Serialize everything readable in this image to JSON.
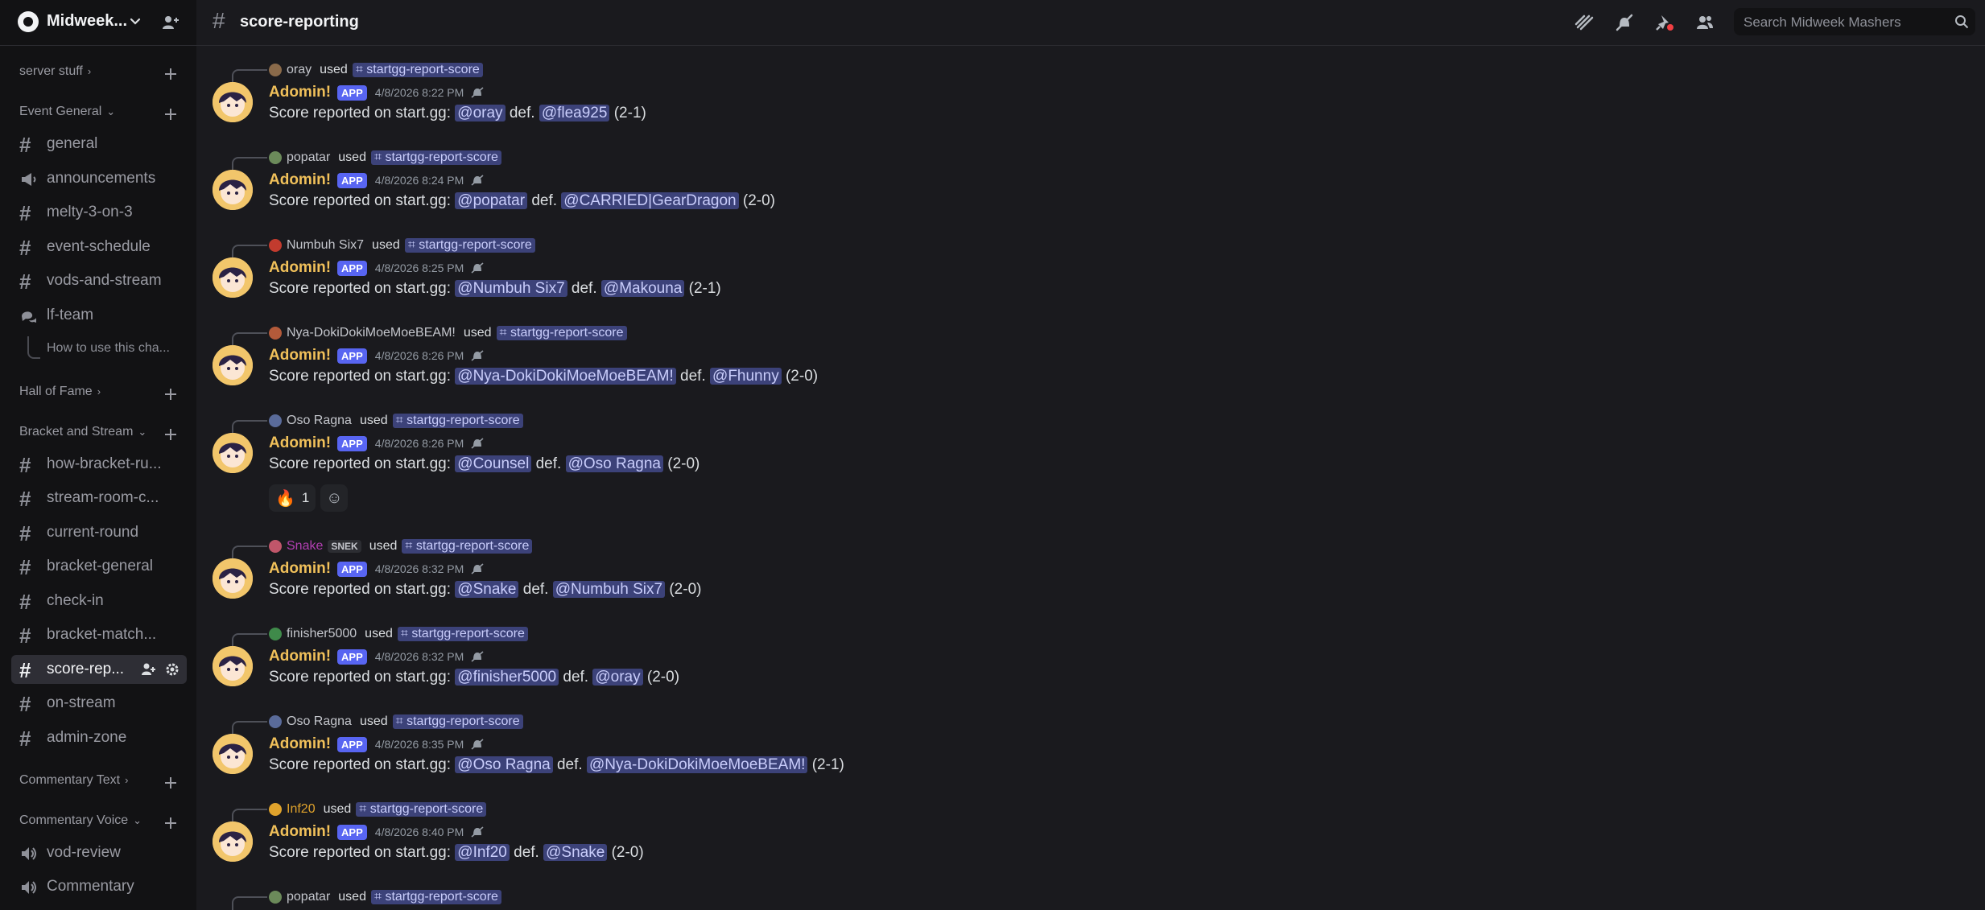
{
  "server": {
    "name": "Midweek..."
  },
  "channel": {
    "title": "score-reporting"
  },
  "search": {
    "placeholder": "Search Midweek Mashers"
  },
  "sidebar": {
    "categories": [
      {
        "label": "server stuff",
        "chev": "›"
      },
      {
        "label": "Event General",
        "chev": "⌄"
      },
      {
        "label": "Hall of Fame",
        "chev": "›"
      },
      {
        "label": "Bracket and Stream",
        "chev": "⌄"
      },
      {
        "label": "Commentary Text",
        "chev": "›"
      },
      {
        "label": "Commentary Voice",
        "chev": "⌄"
      }
    ],
    "channels": [
      {
        "label": "general",
        "icon": "hash"
      },
      {
        "label": "announcements",
        "icon": "megaphone-icon"
      },
      {
        "label": "melty-3-on-3",
        "icon": "hash"
      },
      {
        "label": "event-schedule",
        "icon": "hash"
      },
      {
        "label": "vods-and-stream",
        "icon": "hash"
      },
      {
        "label": "lf-team",
        "icon": "forum-icon"
      },
      {
        "label": "how-bracket-ru...",
        "icon": "hash"
      },
      {
        "label": "stream-room-c...",
        "icon": "hash"
      },
      {
        "label": "current-round",
        "icon": "hash"
      },
      {
        "label": "bracket-general",
        "icon": "hash"
      },
      {
        "label": "check-in",
        "icon": "hash"
      },
      {
        "label": "bracket-match...",
        "icon": "hash"
      },
      {
        "label": "score-rep...",
        "icon": "hash",
        "active": true
      },
      {
        "label": "on-stream",
        "icon": "hash"
      },
      {
        "label": "admin-zone",
        "icon": "hash"
      },
      {
        "label": "vod-review",
        "icon": "speaker-icon"
      },
      {
        "label": "Commentary",
        "icon": "speaker-icon"
      }
    ],
    "thread": {
      "label": "How to use this cha..."
    }
  },
  "messages": [
    {
      "reply_user": "oray",
      "reply_color": "#c4c6cc",
      "used": "used",
      "command": "startgg-report-score",
      "author": "Adomin!",
      "badge": "APP",
      "time": "4/8/2026 8:22 PM",
      "text": "Score reported on start.gg:",
      "winner": "@oray",
      "def": "def.",
      "loser": "@flea925",
      "score": "(2-1)"
    },
    {
      "reply_user": "popatar",
      "reply_color": "#c4c6cc",
      "used": "used",
      "command": "startgg-report-score",
      "author": "Adomin!",
      "badge": "APP",
      "time": "4/8/2026 8:24 PM",
      "text": "Score reported on start.gg:",
      "winner": "@popatar",
      "def": "def.",
      "loser": "@CARRIED|GearDragon",
      "score": "(2-0)"
    },
    {
      "reply_user": "Numbuh Six7",
      "reply_color": "#c4c6cc",
      "used": "used",
      "command": "startgg-report-score",
      "author": "Adomin!",
      "badge": "APP",
      "time": "4/8/2026 8:25 PM",
      "text": "Score reported on start.gg:",
      "winner": "@Numbuh Six7",
      "def": "def.",
      "loser": "@Makouna",
      "score": "(2-1)"
    },
    {
      "reply_user": "Nya-DokiDokiMoeMoeBEAM!",
      "reply_color": "#c4c6cc",
      "used": "used",
      "command": "startgg-report-score",
      "author": "Adomin!",
      "badge": "APP",
      "time": "4/8/2026 8:26 PM",
      "text": "Score reported on start.gg:",
      "winner": "@Nya-DokiDokiMoeMoeBEAM!",
      "def": "def.",
      "loser": "@Fhunny",
      "score": "(2-0)"
    },
    {
      "reply_user": "Oso Ragna",
      "reply_color": "#c4c6cc",
      "used": "used",
      "command": "startgg-report-score",
      "author": "Adomin!",
      "badge": "APP",
      "time": "4/8/2026 8:26 PM",
      "text": "Score reported on start.gg:",
      "winner": "@Counsel",
      "def": "def.",
      "loser": "@Oso Ragna",
      "score": "(2-0)",
      "reaction": {
        "emoji": "🔥",
        "count": "1",
        "add": "☺"
      }
    },
    {
      "reply_user": "Snake",
      "reply_color": "#b23fb2",
      "tag": "SNEK",
      "used": "used",
      "command": "startgg-report-score",
      "author": "Adomin!",
      "badge": "APP",
      "time": "4/8/2026 8:32 PM",
      "text": "Score reported on start.gg:",
      "winner": "@Snake",
      "def": "def.",
      "loser": "@Numbuh Six7",
      "score": "(2-0)"
    },
    {
      "reply_user": "finisher5000",
      "reply_color": "#c4c6cc",
      "used": "used",
      "command": "startgg-report-score",
      "author": "Adomin!",
      "badge": "APP",
      "time": "4/8/2026 8:32 PM",
      "text": "Score reported on start.gg:",
      "winner": "@finisher5000",
      "def": "def.",
      "loser": "@oray",
      "score": "(2-0)"
    },
    {
      "reply_user": "Oso Ragna",
      "reply_color": "#c4c6cc",
      "used": "used",
      "command": "startgg-report-score",
      "author": "Adomin!",
      "badge": "APP",
      "time": "4/8/2026 8:35 PM",
      "text": "Score reported on start.gg:",
      "winner": "@Oso Ragna",
      "def": "def.",
      "loser": "@Nya-DokiDokiMoeMoeBEAM!",
      "score": "(2-1)"
    },
    {
      "reply_user": "Inf20",
      "reply_color": "#e0a32c",
      "used": "used",
      "command": "startgg-report-score",
      "author": "Adomin!",
      "badge": "APP",
      "time": "4/8/2026 8:40 PM",
      "text": "Score reported on start.gg:",
      "winner": "@Inf20",
      "def": "def.",
      "loser": "@Snake",
      "score": "(2-0)"
    },
    {
      "reply_user": "popatar",
      "reply_color": "#c4c6cc",
      "used": "used",
      "command": "startgg-report-score"
    }
  ]
}
